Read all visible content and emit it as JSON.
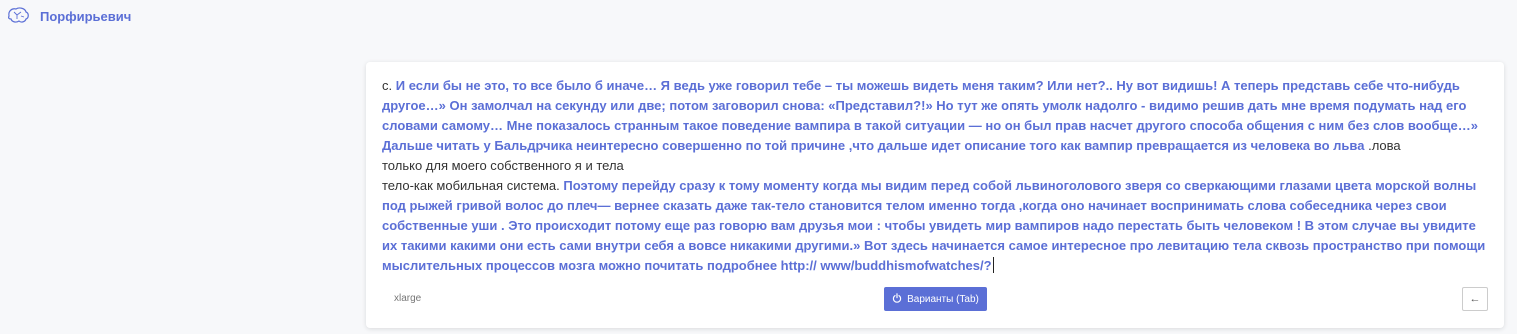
{
  "app": {
    "logo_icon": "brain-icon",
    "title": "Порфирьевич",
    "accent_color": "#5b6fd6"
  },
  "editor": {
    "segments": [
      {
        "text": "с. ",
        "generated": false
      },
      {
        "text": "И если бы не это, то все было б иначе… Я ведь уже говорил тебе – ты можешь видеть меня таким? Или нет?.. Ну вот видишь! А теперь представь себе что-нибудь другое…» Он замолчал на секунду или две; потом заговорил снова: «Представил?!» Но тут же опять умолк надолго - видимо решив дать мне время подумать над его словами самому… Мне показалось странным такое поведение вампира в такой ситуации — но он был прав насчет другого способа общения с ним без слов вообще…» Дальше читать у Бальдрчика неинтересно совершенно по той причине ,что дальше идет описание того как вампир превращается из человека во льва ",
        "generated": true
      },
      {
        "text": ".лова\nтолько для моего собственного я и тела\nтело-как мобильная система. ",
        "generated": false
      },
      {
        "text": "Поэтому перейду сразу к тому моменту когда мы видим перед собой львиноголового зверя со сверкающими глазами цвета морской волны под рыжей гривой волос до плеч— вернее сказать даже так-тело становится телом именно тогда ,когда оно начинает воспринимать слова собеседника через свои собственные уши . Это происходит потому еще раз говорю вам друзья мои : чтобы увидеть мир вампиров надо перестать быть человеком ! В этом случае вы увидите их такими какими они есть сами внутри себя а вовсе никакими другими.» Вот здесь начинается самое интересное про левитацию тела сквозь пространство при помощи мыслительных процессов мозга можно почитать подробнее http:// www/buddhismofwatches/?",
        "generated": true
      }
    ]
  },
  "footer": {
    "model_label": "xlarge",
    "variants_label": "Варианты (Tab)",
    "variants_icon": "power-icon",
    "undo_icon": "arrow-left-icon"
  }
}
